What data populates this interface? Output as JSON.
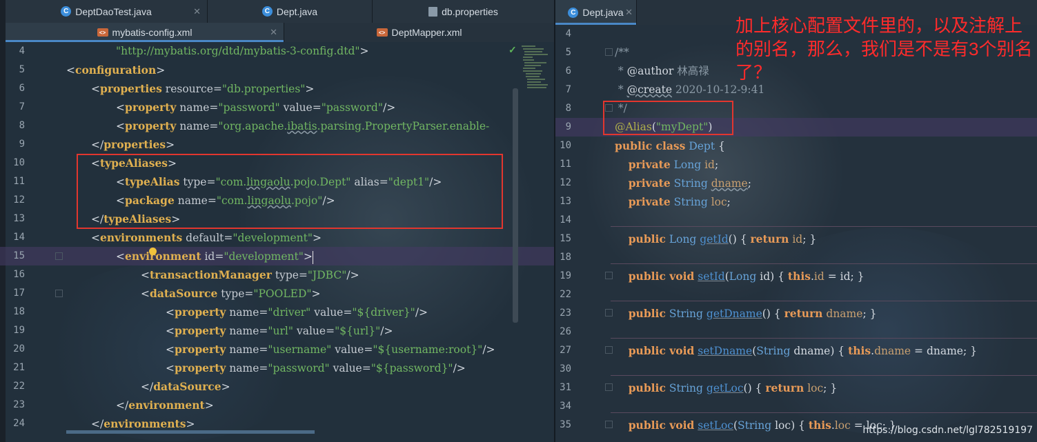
{
  "left_pane": {
    "tabs_row1": [
      {
        "label": "DeptDaoTest.java",
        "icon": "java-class-icon"
      },
      {
        "label": "Dept.java",
        "icon": "java-class-icon"
      },
      {
        "label": "db.properties",
        "icon": "properties-file-icon"
      }
    ],
    "tabs_row2": [
      {
        "label": "mybatis-config.xml",
        "icon": "xml-file-icon"
      },
      {
        "label": "DeptMapper.xml",
        "icon": "xml-file-icon"
      }
    ],
    "line_numbers": [
      "4",
      "5",
      "6",
      "7",
      "8",
      "9",
      "10",
      "11",
      "12",
      "13",
      "14",
      "15",
      "16",
      "17",
      "18",
      "19",
      "20",
      "21",
      "22",
      "23",
      "24"
    ]
  },
  "right_pane": {
    "tab": {
      "label": "Dept.java",
      "icon": "java-class-icon"
    },
    "line_numbers": [
      "4",
      "5",
      "6",
      "7",
      "8",
      "9",
      "10",
      "11",
      "12",
      "13",
      "14",
      "15",
      "18",
      "19",
      "22",
      "23",
      "26",
      "27",
      "30",
      "31",
      "34",
      "35"
    ],
    "javadoc_author": "林高禄",
    "javadoc_create": "2020-10-12-9:41"
  },
  "annotation": {
    "text": "加上核心配置文件里的，以及注解上的别名，那么，我们是不是有3个别名了？"
  },
  "watermark": {
    "text": "https://blog.csdn.net/lgl782519197"
  },
  "colors": {
    "highlight_box": "#e3362e",
    "annotation_text": "#ff2b2b",
    "xml_tag": "#e0b050",
    "string_value": "#71b662",
    "keyword": "#e89a57"
  }
}
